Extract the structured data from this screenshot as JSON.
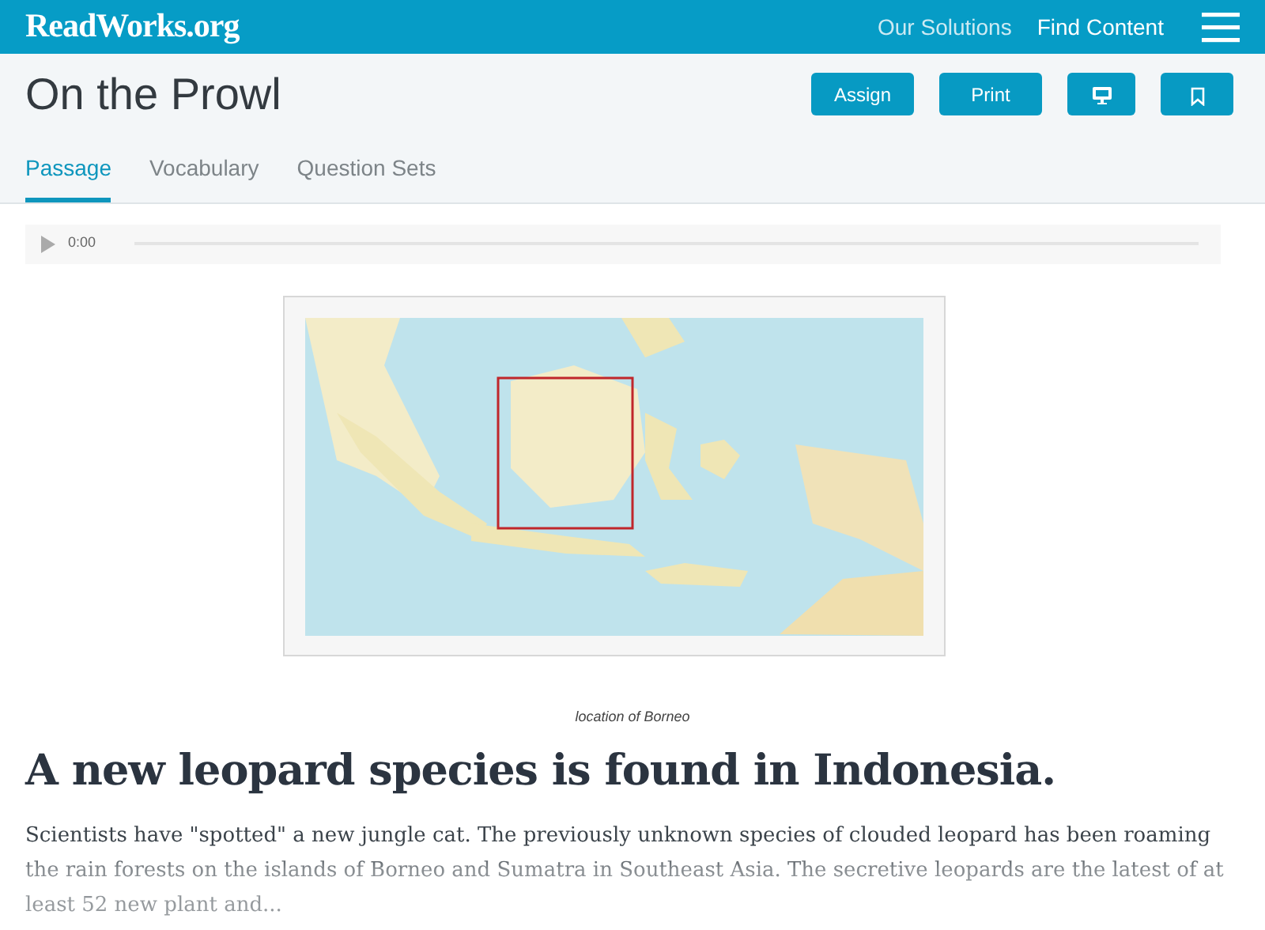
{
  "brand": "ReadWorks.org",
  "nav_links": [
    {
      "label": "Our Solutions",
      "selected": false
    },
    {
      "label": "Find Content",
      "selected": true
    }
  ],
  "title": "On the Prowl",
  "actions": [
    {
      "kind": "text",
      "label": "Assign"
    },
    {
      "kind": "text",
      "label": "Print"
    },
    {
      "kind": "monitor"
    },
    {
      "kind": "bookmark"
    }
  ],
  "tabs": [
    {
      "label": "Passage",
      "selected": true
    },
    {
      "label": "Vocabulary",
      "selected": false
    },
    {
      "label": "Question Sets",
      "selected": false
    }
  ],
  "audio": {
    "time": "0:00"
  },
  "figure": {
    "kind": "picture",
    "caption": "location of Borneo"
  },
  "heading": "A new leopard species is found in Indonesia.",
  "paragraph": "Scientists have \"spotted\" a new jungle cat. The previously unknown species of clouded leopard has been roaming the rain forests on the islands of Borneo and Sumatra in Southeast Asia. The secretive leopards are the latest of at least 52 new plant and..."
}
